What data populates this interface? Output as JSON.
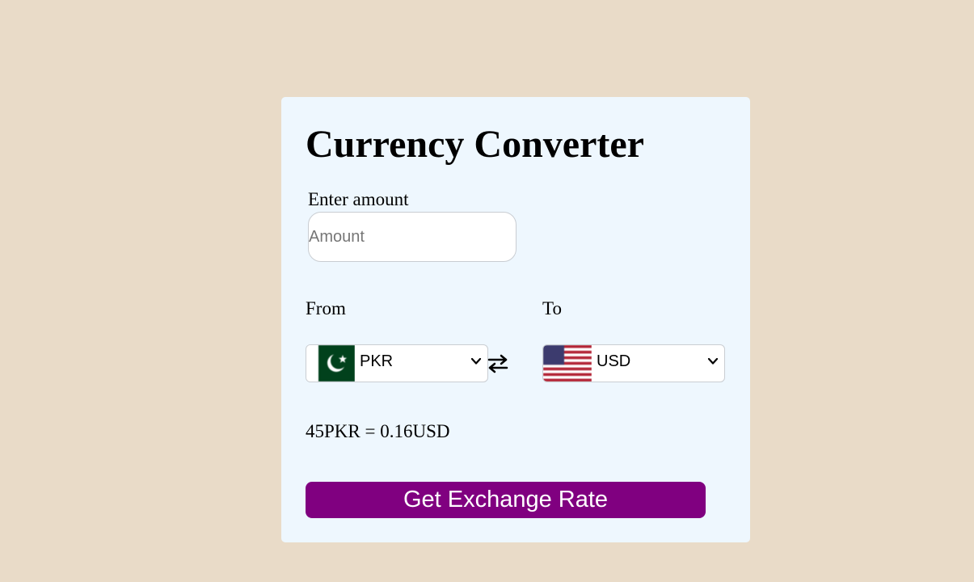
{
  "converter": {
    "title": "Currency Converter",
    "amount_label": "Enter amount",
    "amount_placeholder": "Amount",
    "amount_value": "",
    "from_label": "From",
    "to_label": "To",
    "from_currency": "PKR",
    "to_currency": "USD",
    "from_flag_icon": "pakistan-flag-icon",
    "to_flag_icon": "usa-flag-icon",
    "swap_icon": "swap-arrows-icon",
    "result_text": "45PKR = 0.16USD",
    "button_label": "Get Exchange Rate"
  },
  "colors": {
    "page_background": "#e9dbc8",
    "card_background": "#eef7fe",
    "button_background": "#800080",
    "button_text": "#ffffff"
  }
}
